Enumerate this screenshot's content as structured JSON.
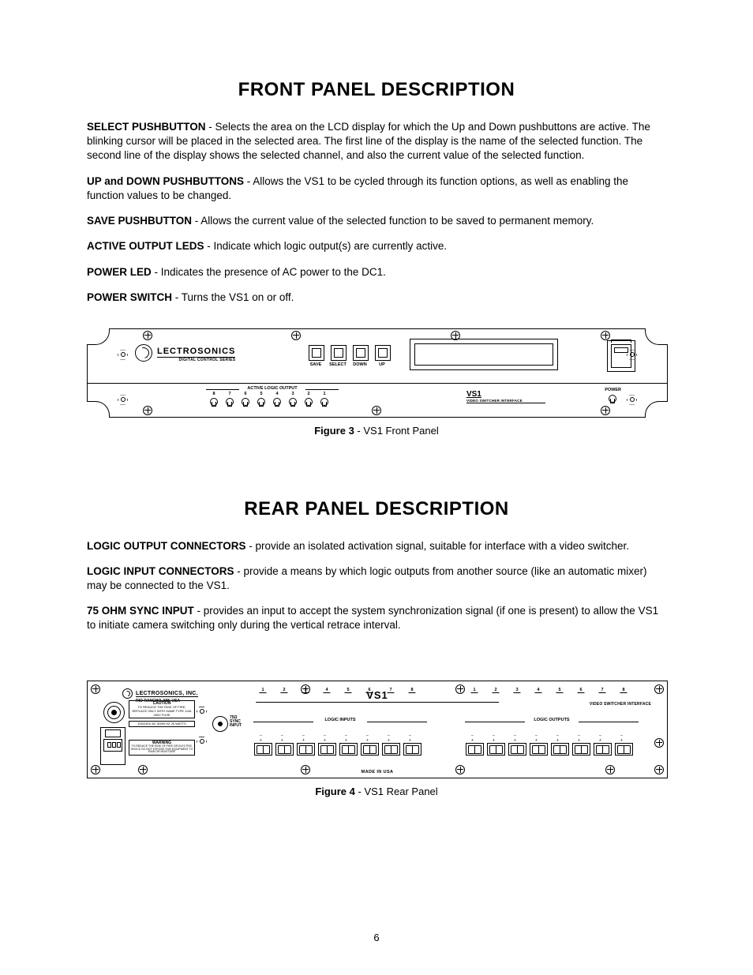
{
  "page_number": "6",
  "sections": {
    "front": {
      "heading": "FRONT PANEL DESCRIPTION",
      "items": [
        {
          "term": "SELECT PUSHBUTTON",
          "body": " - Selects the area on the LCD display for which the Up and Down pushbuttons are active.  The blinking cursor will be placed in the selected area.  The first line of the display is the name of the selected function.  The second line of the display shows the selected channel, and also the current value of the selected function."
        },
        {
          "term": "UP and DOWN PUSHBUTTONS",
          "body": " - Allows the VS1 to be cycled through its function options, as well as enabling the function values to be changed."
        },
        {
          "term": "SAVE PUSHBUTTON",
          "body": " - Allows the current value of the selected function to be saved to permanent memory."
        },
        {
          "term": "ACTIVE OUTPUT LEDS",
          "body": " - Indicate which logic output(s) are currently active."
        },
        {
          "term": "POWER LED",
          "body": " - Indicates the presence of AC power to the DC1."
        },
        {
          "term": "POWER SWITCH",
          "body": " - Turns the VS1 on or off."
        }
      ],
      "figure": {
        "label": "Figure 3",
        "caption": " - VS1 Front Panel"
      }
    },
    "rear": {
      "heading": "REAR PANEL DESCRIPTION",
      "items": [
        {
          "term": "LOGIC OUTPUT CONNECTORS",
          "body": " - provide an isolated activation signal, suitable for interface with a video switcher."
        },
        {
          "term": "LOGIC INPUT CONNECTORS",
          "body": " - provide a means by which logic outputs from another source (like an automatic mixer) may be connected to the VS1."
        },
        {
          "term": "75 OHM SYNC INPUT",
          "body": " - provides an input to accept the system synchronization signal (if one is present) to allow the VS1 to initiate camera switching only during the vertical retrace interval."
        }
      ],
      "figure": {
        "label": "Figure 4",
        "caption": " - VS1 Rear Panel"
      }
    }
  },
  "front_panel": {
    "brand": "LECTROSONICS",
    "brand_sub": "DIGITAL CONTROL SERIES",
    "buttons": [
      "SAVE",
      "SELECT",
      "DOWN",
      "UP"
    ],
    "active_logic_label": "ACTIVE LOGIC OUTPUT",
    "led_numbers": [
      "8",
      "7",
      "6",
      "5",
      "4",
      "3",
      "2",
      "1"
    ],
    "model": "VS1",
    "model_sub": "VIDEO SWITCHER INTERFACE",
    "power_label": "POWER"
  },
  "rear_panel": {
    "brand": "LECTROSONICS, INC.",
    "brand_sub": "RIO RANCHO, NM, USA",
    "caution_hd": "CAUTION",
    "caution_body": "TO REDUCE THE RISK OF FIRE, REPLACE ONLY WITH SAME TYPE 1/4A 250V FUSE",
    "spec": "100/240V AC   50/60 HZ   25 WATTS",
    "warning_hd": "WARNING",
    "warning_body": "TO REDUCE THE RISK OF FIRE OR ELECTRIC SHOCK DO NOT EXPOSE THIS EQUIPMENT TO RAIN OR MOISTURE",
    "sync_label": "75Ω SYNC INPUT",
    "model": "VS1",
    "model_sub": "VIDEO SWITCHER INTERFACE",
    "inputs_label": "LOGIC INPUTS",
    "outputs_label": "LOGIC OUTPUTS",
    "channel_numbers": [
      "1",
      "2",
      "3",
      "4",
      "5",
      "6",
      "7",
      "8"
    ],
    "polarity": "– +",
    "made": "MADE IN USA"
  }
}
